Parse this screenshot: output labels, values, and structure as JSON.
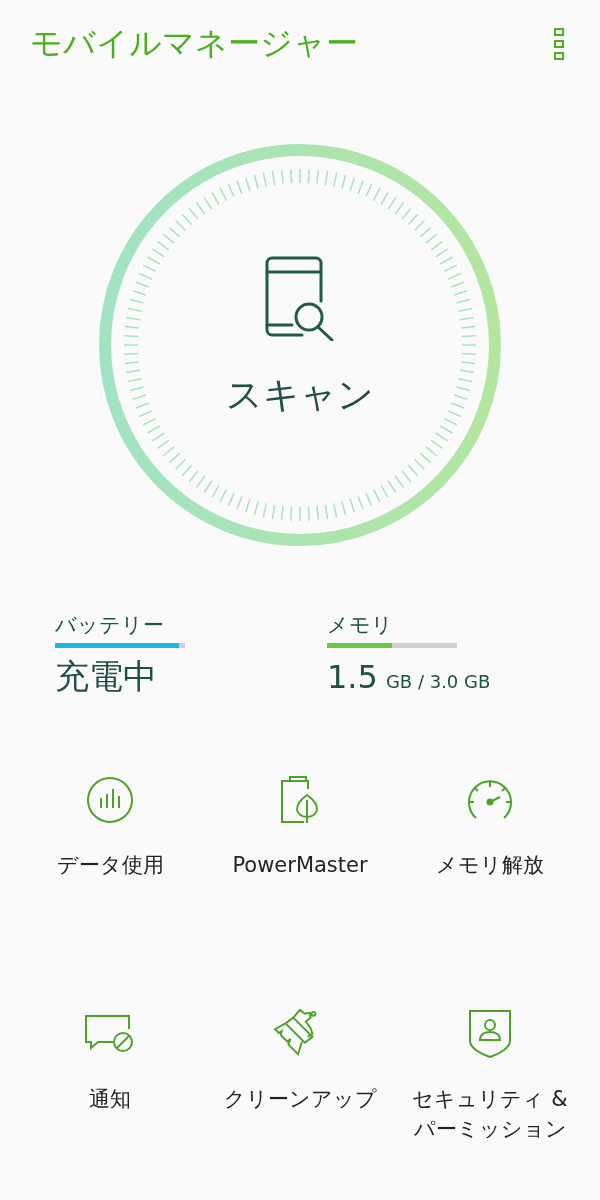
{
  "app_bar": {
    "title": "モバイルマネージャー"
  },
  "scan": {
    "label": "スキャン"
  },
  "battery": {
    "label": "バッテリー",
    "level": 0.95,
    "value": "充電中"
  },
  "memory": {
    "label": "メモリ",
    "level": 0.5,
    "used": "1.5",
    "unit": "GB / 3.0 GB"
  },
  "tools": [
    {
      "kind": "data",
      "label": "データ使用"
    },
    {
      "kind": "power",
      "label": "PowerMaster"
    },
    {
      "kind": "boost",
      "label": "メモリ解放"
    },
    {
      "kind": "notify",
      "label": "通知"
    },
    {
      "kind": "clean",
      "label": "クリーンアップ"
    },
    {
      "kind": "security",
      "label": "セキュリティ & パーミッション"
    }
  ]
}
